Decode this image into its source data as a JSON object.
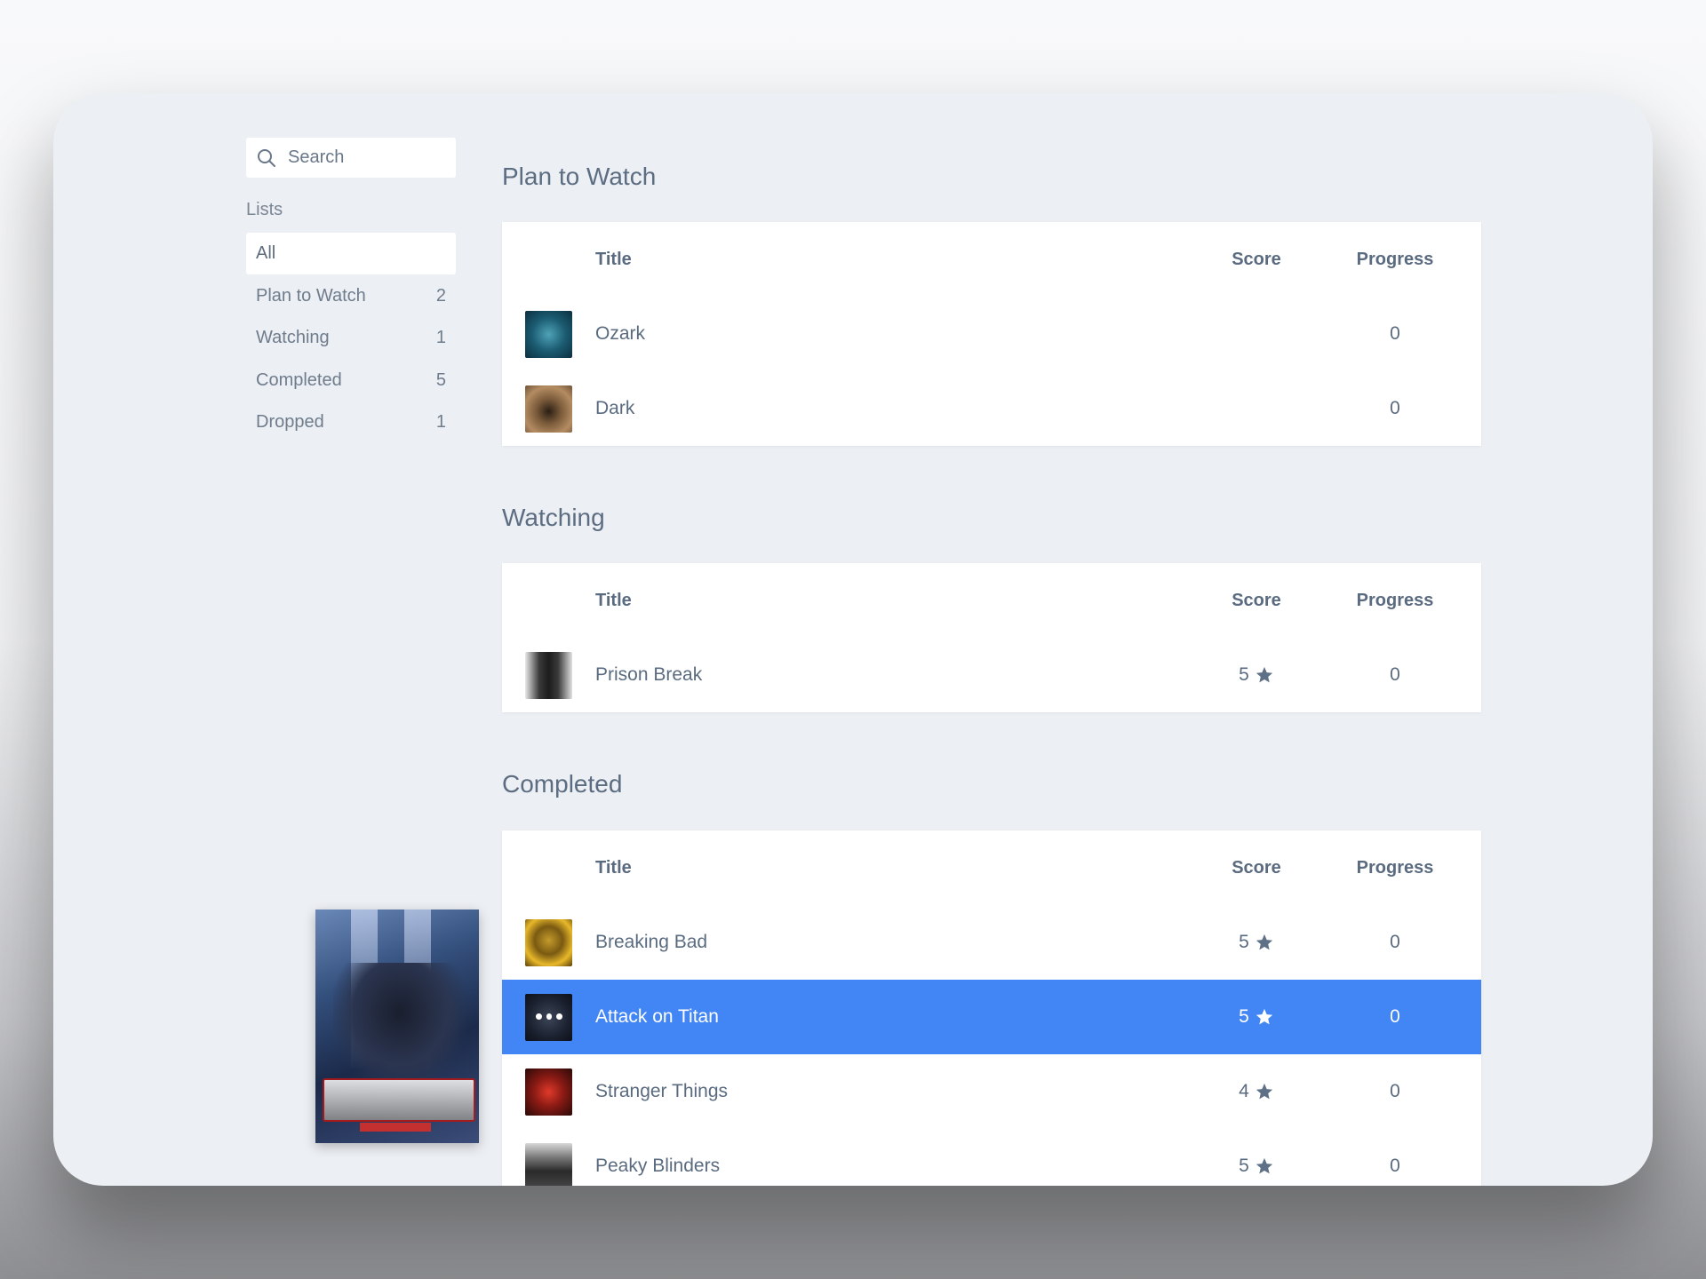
{
  "sidebar": {
    "search_placeholder": "Search",
    "lists_label": "Lists",
    "items": [
      {
        "label": "All",
        "count": ""
      },
      {
        "label": "Plan to Watch",
        "count": "2"
      },
      {
        "label": "Watching",
        "count": "1"
      },
      {
        "label": "Completed",
        "count": "5"
      },
      {
        "label": "Dropped",
        "count": "1"
      }
    ]
  },
  "columns": {
    "title": "Title",
    "score": "Score",
    "progress": "Progress"
  },
  "sections": [
    {
      "title": "Plan to Watch",
      "rows": [
        {
          "title": "Ozark",
          "score": "",
          "progress": "0",
          "thumb": "ozark-thumbnail"
        },
        {
          "title": "Dark",
          "score": "",
          "progress": "0",
          "thumb": "dark-thumbnail"
        }
      ]
    },
    {
      "title": "Watching",
      "rows": [
        {
          "title": "Prison Break",
          "score": "5",
          "progress": "0",
          "thumb": "prison-break-thumbnail"
        }
      ]
    },
    {
      "title": "Completed",
      "rows": [
        {
          "title": "Breaking Bad",
          "score": "5",
          "progress": "0",
          "thumb": "breaking-bad-thumbnail"
        },
        {
          "title": "Attack on Titan",
          "score": "5",
          "progress": "0",
          "thumb": "attack-on-titan-thumbnail",
          "selected": true
        },
        {
          "title": "Stranger Things",
          "score": "4",
          "progress": "0",
          "thumb": "stranger-things-thumbnail"
        },
        {
          "title": "Peaky Blinders",
          "score": "5",
          "progress": "0",
          "thumb": "peaky-blinders-thumbnail"
        }
      ]
    }
  ],
  "icons": {
    "search": "search-icon",
    "star": "star-icon"
  },
  "colors": {
    "accent": "#4285f4",
    "background": "#eceff3",
    "text": "#5a6b80"
  }
}
